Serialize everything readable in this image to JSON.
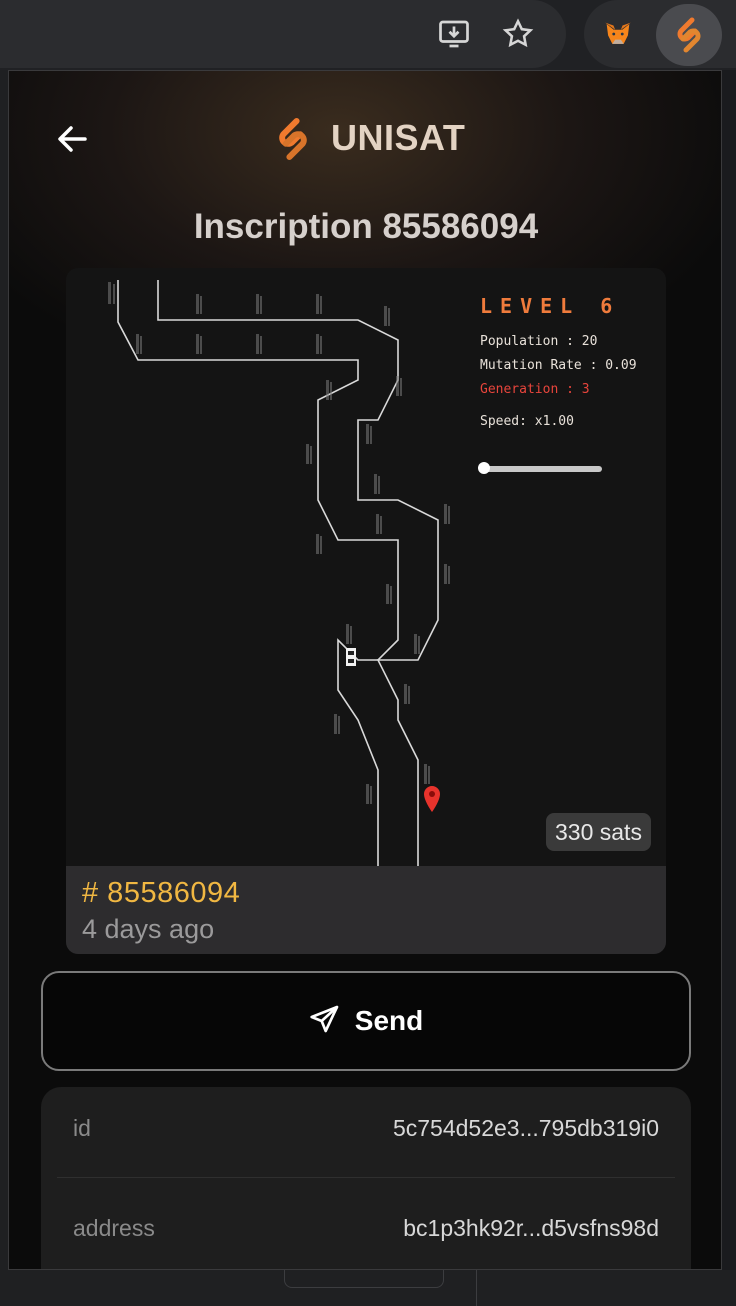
{
  "header": {
    "brand": "UNISAT",
    "title": "Inscription 85586094"
  },
  "game": {
    "level": "LEVEL 6",
    "population": "Population : 20",
    "mutation_rate": "Mutation Rate : 0.09",
    "generation": "Generation : 3",
    "speed": "Speed: x1.00",
    "speed_slider_value": 0,
    "colors": {
      "level": "#ef7b3c",
      "generation": "#e8453c",
      "track": "#d9d9d9"
    }
  },
  "card": {
    "price": "330 sats",
    "number": "# 85586094",
    "time": "4 days ago"
  },
  "actions": {
    "send_label": "Send"
  },
  "details": [
    {
      "key": "id",
      "value": "5c754d52e3...795db319i0"
    },
    {
      "key": "address",
      "value": "bc1p3hk92r...d5vsfns98d"
    }
  ],
  "icons": {
    "back": "arrow-left-icon",
    "logo": "unisat-logo",
    "send": "paper-plane-icon",
    "toolbar": [
      "install-app-icon",
      "star-icon",
      "metamask-fox-icon",
      "unisat-extension-icon"
    ]
  }
}
